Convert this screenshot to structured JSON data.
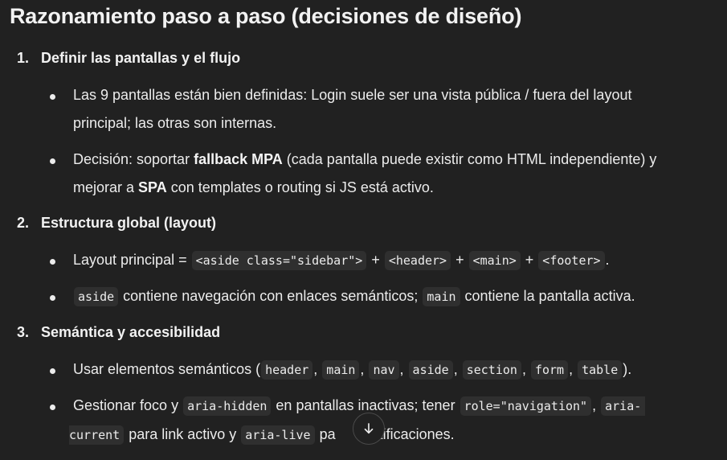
{
  "title": "Razonamiento paso a paso (decisiones de diseño)",
  "sections": [
    {
      "number": "1.",
      "heading": "Definir las pantallas y el flujo",
      "bullets": [
        {
          "l1": "Las 9 pantallas están bien definidas: Login suele ser una vista pública / fuera del layout",
          "l2": "principal; las otras son internas."
        },
        {
          "l1_a": "Decisión: soportar ",
          "l1_b": "fallback MPA",
          "l1_c": " (cada pantalla puede existir como HTML independiente) y",
          "l2_a": "mejorar a ",
          "l2_b": "SPA",
          "l2_c": " con templates o routing si JS está activo."
        }
      ]
    },
    {
      "number": "2.",
      "heading": "Estructura global (layout)",
      "bullets": [
        {
          "a": "Layout principal = ",
          "c1": "<aside class=\"sidebar\">",
          "p1": " + ",
          "c2": "<header>",
          "p2": " + ",
          "c3": "<main>",
          "p3": " + ",
          "c4": "<footer>",
          "end": "."
        },
        {
          "c1": "aside",
          "t1": " contiene navegación con enlaces semánticos; ",
          "c2": "main",
          "t2": " contiene la pantalla activa."
        }
      ]
    },
    {
      "number": "3.",
      "heading": "Semántica y accesibilidad",
      "bullets": [
        {
          "a": "Usar elementos semánticos (",
          "codes": [
            "header",
            "main",
            "nav",
            "aside",
            "section",
            "form",
            "table"
          ],
          "sep": ", ",
          "end": ")."
        },
        {
          "a": "Gestionar foco y ",
          "c1": "aria-hidden",
          "t1": " en pantallas inactivas; tener ",
          "c2": "role=\"navigation\"",
          "t2": ", ",
          "c3a": "aria-",
          "c3b": "current",
          "t3": " para link activo y ",
          "c4": "aria-live",
          "t4": " pa",
          "t5": "notificaciones."
        }
      ]
    }
  ],
  "scroll_button": {
    "icon": "arrow-down-icon"
  }
}
